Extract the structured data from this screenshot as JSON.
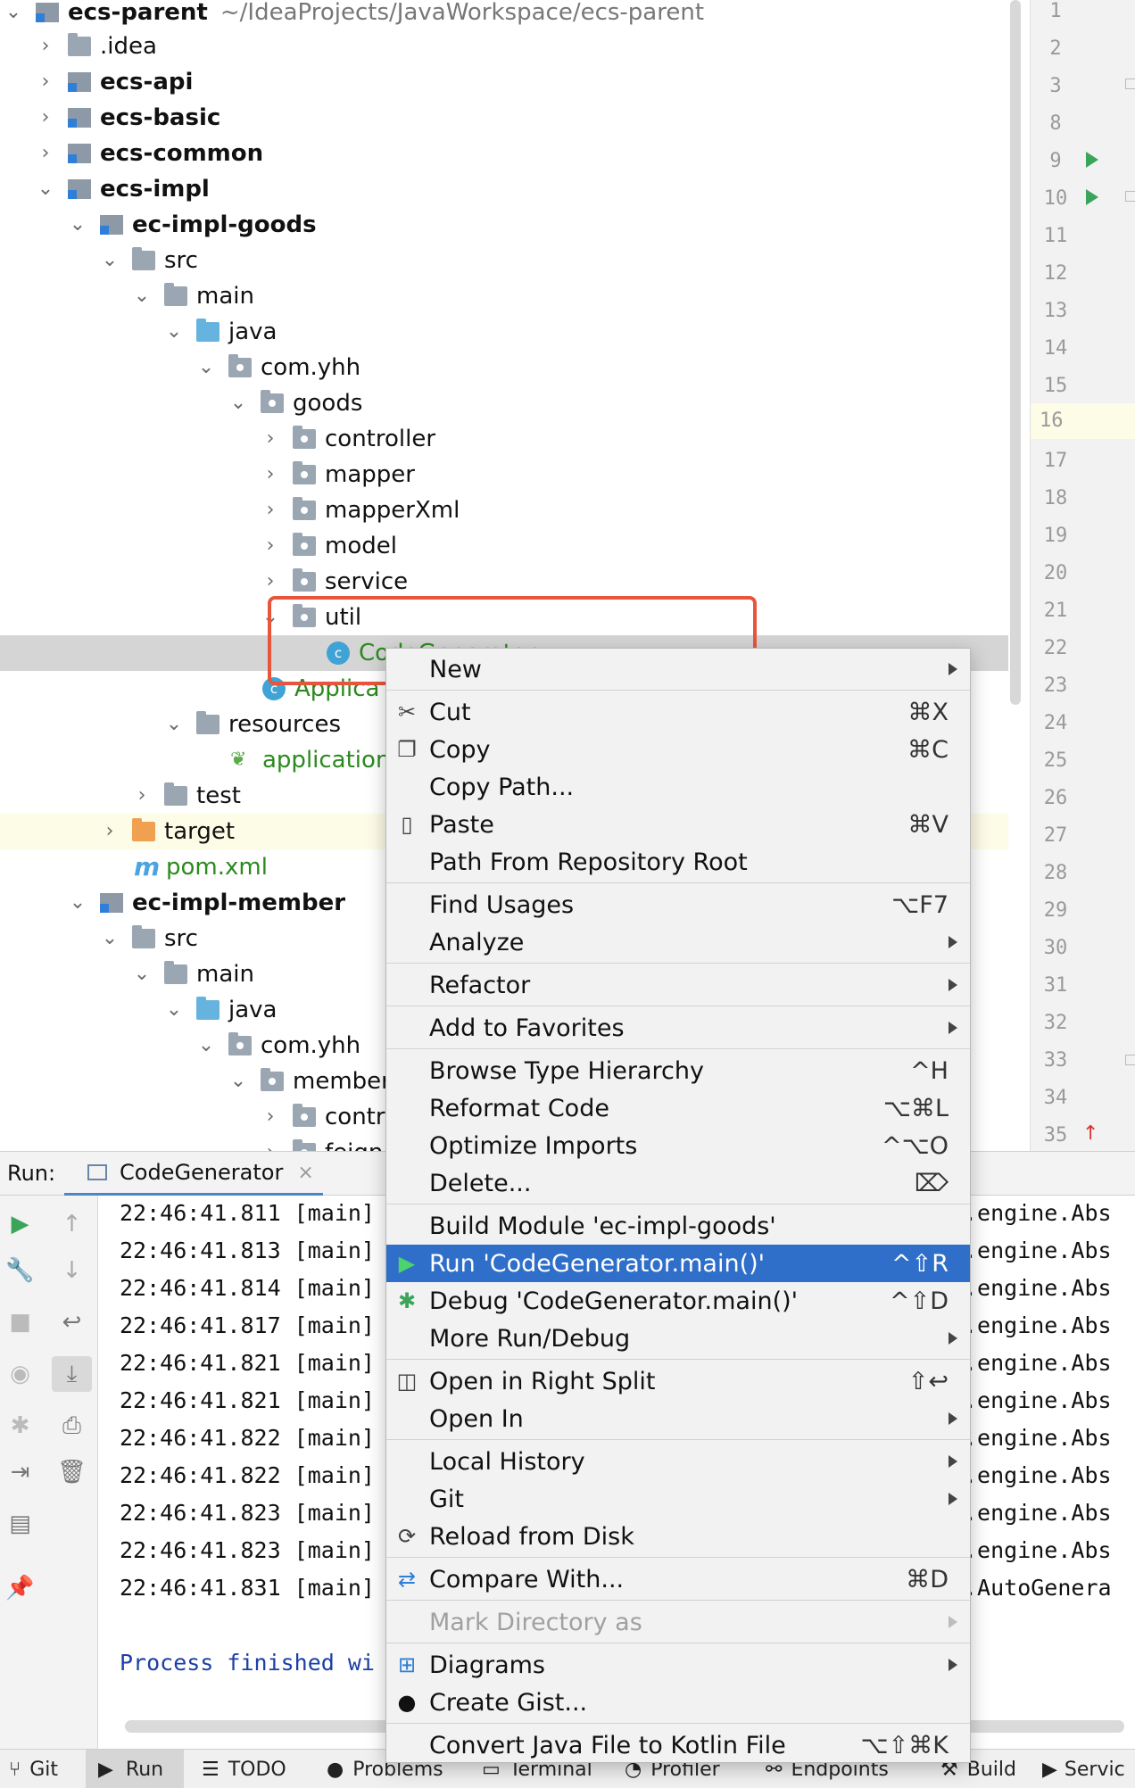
{
  "tree": {
    "root": {
      "name": "ecs-parent",
      "path": "~/IdeaProjects/JavaWorkspace/ecs-parent"
    },
    "items": [
      {
        "label": ".idea"
      },
      {
        "label": "ecs-api"
      },
      {
        "label": "ecs-basic"
      },
      {
        "label": "ecs-common"
      },
      {
        "label": "ecs-impl"
      },
      {
        "label": "ec-impl-goods"
      },
      {
        "label": "src"
      },
      {
        "label": "main"
      },
      {
        "label": "java"
      },
      {
        "label": "com.yhh"
      },
      {
        "label": "goods"
      },
      {
        "label": "controller"
      },
      {
        "label": "mapper"
      },
      {
        "label": "mapperXml"
      },
      {
        "label": "model"
      },
      {
        "label": "service"
      },
      {
        "label": "util"
      },
      {
        "label": "CodeGenerator"
      },
      {
        "label": "Applica"
      },
      {
        "label": "resources"
      },
      {
        "label": "application"
      },
      {
        "label": "test"
      },
      {
        "label": "target"
      },
      {
        "label": "pom.xml"
      },
      {
        "label": "ec-impl-member"
      },
      {
        "label": "src"
      },
      {
        "label": "main"
      },
      {
        "label": "java"
      },
      {
        "label": "com.yhh"
      },
      {
        "label": "member"
      },
      {
        "label": "contr"
      },
      {
        "label": "feign"
      }
    ]
  },
  "gutter": {
    "line_numbers": [
      "1",
      "2",
      "3",
      "8",
      "9",
      "10",
      "11",
      "12",
      "13",
      "14",
      "15",
      "16",
      "17",
      "18",
      "19",
      "20",
      "21",
      "22",
      "23",
      "24",
      "25",
      "26",
      "27",
      "28",
      "29",
      "30",
      "31",
      "32",
      "33",
      "34",
      "35"
    ]
  },
  "run_panel": {
    "label": "Run:",
    "tab": "CodeGenerator",
    "console": [
      "22:46:41.811 [main]",
      "22:46:41.813 [main]",
      "22:46:41.814 [main]",
      "22:46:41.817 [main]",
      "22:46:41.821 [main]",
      "22:46:41.821 [main]",
      "22:46:41.822 [main]",
      "22:46:41.822 [main]",
      "22:46:41.823 [main]",
      "22:46:41.823 [main]",
      "22:46:41.831 [main]"
    ],
    "console_right": [
      ".engine.Abs",
      ".engine.Abs",
      ".engine.Abs",
      ".engine.Abs",
      ".engine.Abs",
      ".engine.Abs",
      ".engine.Abs",
      ".engine.Abs",
      ".engine.Abs",
      ".engine.Abs",
      ".AutoGenera"
    ],
    "process_line": "Process finished wi"
  },
  "context_menu": {
    "items": [
      {
        "label": "New",
        "shortcut": "",
        "submenu": true
      },
      {
        "label": "Cut",
        "shortcut": "⌘X",
        "icon": "cut-icon"
      },
      {
        "label": "Copy",
        "shortcut": "⌘C",
        "icon": "copy-icon"
      },
      {
        "label": "Copy Path...",
        "shortcut": ""
      },
      {
        "label": "Paste",
        "shortcut": "⌘V",
        "icon": "paste-icon"
      },
      {
        "label": "Path From Repository Root",
        "shortcut": ""
      },
      {
        "label": "Find Usages",
        "shortcut": "⌥F7"
      },
      {
        "label": "Analyze",
        "shortcut": "",
        "submenu": true
      },
      {
        "label": "Refactor",
        "shortcut": "",
        "submenu": true
      },
      {
        "label": "Add to Favorites",
        "shortcut": "",
        "submenu": true
      },
      {
        "label": "Browse Type Hierarchy",
        "shortcut": "^H"
      },
      {
        "label": "Reformat Code",
        "shortcut": "⌥⌘L"
      },
      {
        "label": "Optimize Imports",
        "shortcut": "^⌥O"
      },
      {
        "label": "Delete...",
        "shortcut": "⌦"
      },
      {
        "label": "Build Module 'ec-impl-goods'",
        "shortcut": ""
      },
      {
        "label": "Run 'CodeGenerator.main()'",
        "shortcut": "^⇧R",
        "icon": "run-icon",
        "active": true
      },
      {
        "label": "Debug 'CodeGenerator.main()'",
        "shortcut": "^⇧D",
        "icon": "debug-icon"
      },
      {
        "label": "More Run/Debug",
        "shortcut": "",
        "submenu": true
      },
      {
        "label": "Open in Right Split",
        "shortcut": "⇧↩",
        "icon": "split-icon"
      },
      {
        "label": "Open In",
        "shortcut": "",
        "submenu": true
      },
      {
        "label": "Local History",
        "shortcut": "",
        "submenu": true
      },
      {
        "label": "Git",
        "shortcut": "",
        "submenu": true
      },
      {
        "label": "Reload from Disk",
        "shortcut": "",
        "icon": "reload-icon"
      },
      {
        "label": "Compare With...",
        "shortcut": "⌘D",
        "icon": "compare-icon"
      },
      {
        "label": "Mark Directory as",
        "shortcut": "",
        "submenu": true,
        "disabled": true
      },
      {
        "label": "Diagrams",
        "shortcut": "",
        "submenu": true,
        "icon": "diagram-icon"
      },
      {
        "label": "Create Gist...",
        "shortcut": "",
        "icon": "github-icon"
      },
      {
        "label": "Convert Java File to Kotlin File",
        "shortcut": "⌥⇧⌘K"
      }
    ]
  },
  "status_bar": {
    "items": [
      "Git",
      "Run",
      "TODO",
      "Problems",
      "Terminal",
      "Profiler",
      "Endpoints",
      "Build",
      "Servic"
    ]
  },
  "colors": {
    "selection": "#2f6fc9",
    "highlight_box": "#e8553c",
    "green_text": "#2b8a1e"
  }
}
